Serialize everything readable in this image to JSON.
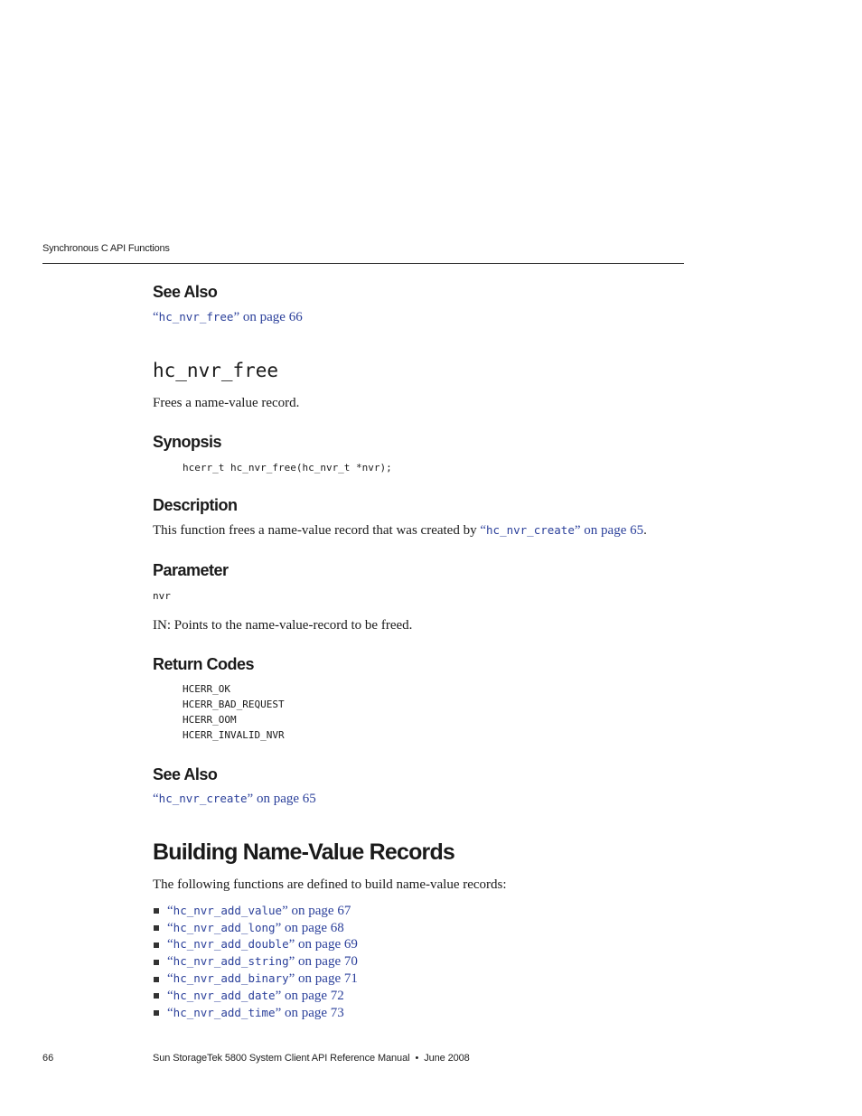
{
  "header": {
    "running_head": "Synchronous C API Functions"
  },
  "see_also_top": {
    "heading": "See Also",
    "link": {
      "open_quote": "“",
      "code": "hc_nvr_free",
      "close_quote": "”",
      "suffix": " on page 66"
    }
  },
  "function": {
    "name": "hc_nvr_free",
    "summary": "Frees a name-value record.",
    "synopsis": {
      "heading": "Synopsis",
      "code": "hcerr_t hc_nvr_free(hc_nvr_t *nvr);"
    },
    "description": {
      "heading": "Description",
      "text_before": "This function frees a name-value record that was created by ",
      "link": {
        "open_quote": "“",
        "code": "hc_nvr_create",
        "close_quote": "”",
        "suffix": " on page 65"
      },
      "text_after": "."
    },
    "parameter": {
      "heading": "Parameter",
      "name": "nvr",
      "text": "IN: Points to the name-value-record to be freed."
    },
    "return_codes": {
      "heading": "Return Codes",
      "codes": [
        "HCERR_OK",
        "HCERR_BAD_REQUEST",
        "HCERR_OOM",
        "HCERR_INVALID_NVR"
      ]
    },
    "see_also": {
      "heading": "See Also",
      "link": {
        "open_quote": "“",
        "code": "hc_nvr_create",
        "close_quote": "”",
        "suffix": " on page 65"
      }
    }
  },
  "section": {
    "heading": "Building Name-Value Records",
    "intro": "The following functions are defined to build name-value records:",
    "items": [
      {
        "open_quote": "“",
        "code": "hc_nvr_add_value",
        "close_quote": "”",
        "suffix": " on page 67"
      },
      {
        "open_quote": "“",
        "code": "hc_nvr_add_long",
        "close_quote": "”",
        "suffix": " on page 68"
      },
      {
        "open_quote": "“",
        "code": "hc_nvr_add_double",
        "close_quote": "”",
        "suffix": " on page 69"
      },
      {
        "open_quote": "“",
        "code": "hc_nvr_add_string",
        "close_quote": "”",
        "suffix": " on page 70"
      },
      {
        "open_quote": "“",
        "code": "hc_nvr_add_binary",
        "close_quote": "”",
        "suffix": " on page 71"
      },
      {
        "open_quote": "“",
        "code": "hc_nvr_add_date",
        "close_quote": "”",
        "suffix": " on page 72"
      },
      {
        "open_quote": "“",
        "code": "hc_nvr_add_time",
        "close_quote": "”",
        "suffix": " on page 73"
      }
    ]
  },
  "footer": {
    "page_number": "66",
    "manual_title": "Sun StorageTek 5800 System Client API Reference Manual",
    "separator": "•",
    "date": "June 2008"
  },
  "colors": {
    "link": "#2a3f9a",
    "text": "#1a1a1a"
  }
}
